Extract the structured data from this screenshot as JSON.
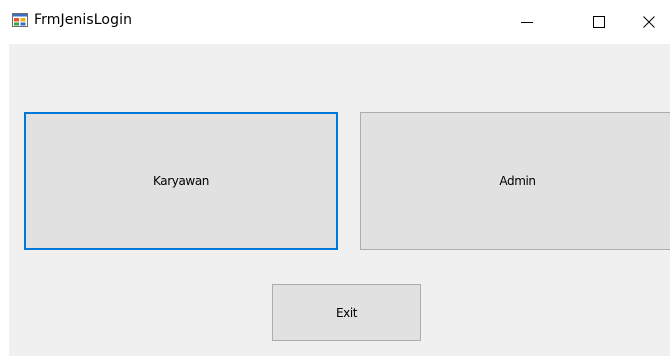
{
  "window": {
    "title": "FrmJenisLogin",
    "icon": "winforms-app-icon",
    "controls": {
      "minimize_icon": "minimize-icon",
      "maximize_icon": "maximize-icon",
      "close_icon": "close-icon"
    }
  },
  "buttons": {
    "karyawan_label": "Karyawan",
    "admin_label": "Admin",
    "exit_label": "Exit"
  },
  "colors": {
    "client_background": "#f0f0f0",
    "button_face": "#e1e1e1",
    "button_border": "#adadad",
    "focus_border": "#0078d7"
  },
  "state": {
    "focused_button": "Karyawan"
  }
}
